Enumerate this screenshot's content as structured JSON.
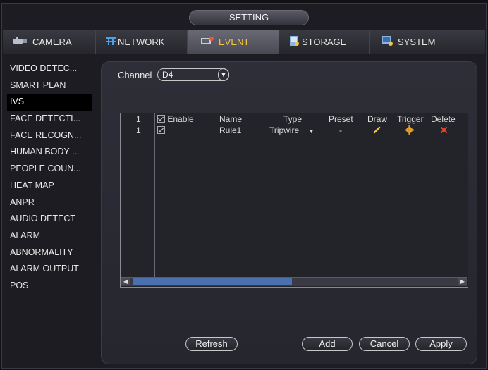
{
  "window": {
    "title": "SETTING"
  },
  "tabs": [
    {
      "label": "CAMERA",
      "icon": "camera-icon"
    },
    {
      "label": "NETWORK",
      "icon": "network-icon"
    },
    {
      "label": "EVENT",
      "icon": "event-icon",
      "active": true
    },
    {
      "label": "STORAGE",
      "icon": "storage-icon"
    },
    {
      "label": "SYSTEM",
      "icon": "system-icon"
    }
  ],
  "sidebar": {
    "items": [
      {
        "label": "VIDEO DETEC..."
      },
      {
        "label": "SMART PLAN"
      },
      {
        "label": "IVS",
        "active": true
      },
      {
        "label": "FACE DETECTI..."
      },
      {
        "label": "FACE RECOGN..."
      },
      {
        "label": "HUMAN BODY ..."
      },
      {
        "label": "PEOPLE COUN..."
      },
      {
        "label": "HEAT MAP"
      },
      {
        "label": "ANPR"
      },
      {
        "label": "AUDIO DETECT"
      },
      {
        "label": "ALARM"
      },
      {
        "label": "ABNORMALITY"
      },
      {
        "label": "ALARM OUTPUT"
      },
      {
        "label": "POS"
      }
    ]
  },
  "channel": {
    "label": "Channel",
    "value": "D4"
  },
  "table": {
    "headers": {
      "index": "1",
      "enable": "Enable",
      "name": "Name",
      "type": "Type",
      "preset": "Preset",
      "draw": "Draw",
      "trigger": "Trigger",
      "delete": "Delete"
    },
    "rows": [
      {
        "index": "1",
        "enabled": true,
        "name": "Rule1",
        "type": "Tripwire",
        "preset": "-"
      }
    ]
  },
  "buttons": {
    "refresh": "Refresh",
    "add": "Add",
    "cancel": "Cancel",
    "apply": "Apply"
  },
  "colors": {
    "accent": "#f4c542",
    "delete": "#e0442a",
    "scroll_thumb": "#4a70b0"
  }
}
